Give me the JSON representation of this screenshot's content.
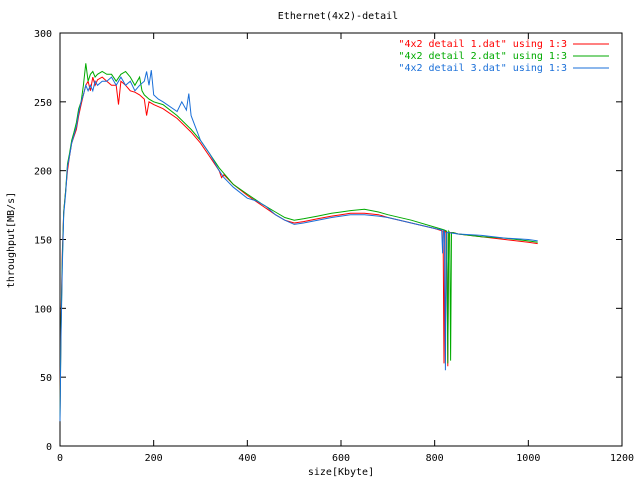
{
  "chart_data": {
    "type": "line",
    "title": "Ethernet(4x2)-detail",
    "xlabel": "size[Kbyte]",
    "ylabel": "throughput[MB/s]",
    "xlim": [
      0,
      1200
    ],
    "ylim": [
      0,
      300
    ],
    "xticks": [
      "0",
      "200",
      "400",
      "600",
      "800",
      "1000",
      "1200"
    ],
    "yticks": [
      "0",
      "50",
      "100",
      "150",
      "200",
      "250",
      "300"
    ],
    "grid": false,
    "legend_position": "top-right",
    "series": [
      {
        "name": "\"4x2 detail 1.dat\" using 1:3",
        "color": "#ff0000",
        "points": [
          [
            0,
            25
          ],
          [
            2,
            85
          ],
          [
            5,
            140
          ],
          [
            8,
            170
          ],
          [
            12,
            185
          ],
          [
            16,
            200
          ],
          [
            20,
            210
          ],
          [
            25,
            220
          ],
          [
            30,
            225
          ],
          [
            35,
            230
          ],
          [
            40,
            240
          ],
          [
            45,
            248
          ],
          [
            50,
            255
          ],
          [
            55,
            262
          ],
          [
            60,
            265
          ],
          [
            65,
            258
          ],
          [
            70,
            268
          ],
          [
            75,
            262
          ],
          [
            80,
            266
          ],
          [
            90,
            268
          ],
          [
            100,
            265
          ],
          [
            110,
            262
          ],
          [
            120,
            262
          ],
          [
            125,
            248
          ],
          [
            130,
            265
          ],
          [
            140,
            262
          ],
          [
            150,
            258
          ],
          [
            160,
            257
          ],
          [
            170,
            255
          ],
          [
            180,
            252
          ],
          [
            185,
            240
          ],
          [
            190,
            250
          ],
          [
            200,
            248
          ],
          [
            220,
            245
          ],
          [
            250,
            238
          ],
          [
            280,
            228
          ],
          [
            300,
            220
          ],
          [
            320,
            210
          ],
          [
            340,
            200
          ],
          [
            345,
            195
          ],
          [
            350,
            197
          ],
          [
            370,
            190
          ],
          [
            400,
            182
          ],
          [
            430,
            175
          ],
          [
            460,
            168
          ],
          [
            480,
            164
          ],
          [
            500,
            162
          ],
          [
            520,
            163
          ],
          [
            550,
            165
          ],
          [
            580,
            167
          ],
          [
            600,
            168
          ],
          [
            620,
            169
          ],
          [
            650,
            169
          ],
          [
            680,
            168
          ],
          [
            700,
            166
          ],
          [
            750,
            162
          ],
          [
            800,
            158
          ],
          [
            818,
            156
          ],
          [
            820,
            60
          ],
          [
            822,
            156
          ],
          [
            826,
            155
          ],
          [
            828,
            58
          ],
          [
            830,
            155
          ],
          [
            840,
            155
          ],
          [
            850,
            154
          ],
          [
            900,
            152
          ],
          [
            950,
            150
          ],
          [
            1000,
            148
          ],
          [
            1020,
            147
          ]
        ]
      },
      {
        "name": "\"4x2 detail 2.dat\" using 1:3",
        "color": "#00aa00",
        "points": [
          [
            0,
            20
          ],
          [
            2,
            80
          ],
          [
            5,
            135
          ],
          [
            8,
            170
          ],
          [
            12,
            185
          ],
          [
            16,
            205
          ],
          [
            20,
            212
          ],
          [
            25,
            222
          ],
          [
            30,
            228
          ],
          [
            35,
            235
          ],
          [
            40,
            245
          ],
          [
            45,
            250
          ],
          [
            50,
            262
          ],
          [
            55,
            278
          ],
          [
            60,
            265
          ],
          [
            65,
            270
          ],
          [
            70,
            272
          ],
          [
            75,
            268
          ],
          [
            80,
            270
          ],
          [
            90,
            272
          ],
          [
            100,
            270
          ],
          [
            110,
            270
          ],
          [
            120,
            265
          ],
          [
            130,
            270
          ],
          [
            140,
            272
          ],
          [
            150,
            268
          ],
          [
            160,
            262
          ],
          [
            170,
            268
          ],
          [
            175,
            258
          ],
          [
            180,
            255
          ],
          [
            190,
            252
          ],
          [
            200,
            250
          ],
          [
            220,
            248
          ],
          [
            250,
            240
          ],
          [
            280,
            230
          ],
          [
            300,
            222
          ],
          [
            320,
            212
          ],
          [
            340,
            202
          ],
          [
            350,
            198
          ],
          [
            370,
            190
          ],
          [
            400,
            183
          ],
          [
            430,
            176
          ],
          [
            460,
            170
          ],
          [
            480,
            166
          ],
          [
            500,
            164
          ],
          [
            520,
            165
          ],
          [
            550,
            167
          ],
          [
            580,
            169
          ],
          [
            600,
            170
          ],
          [
            620,
            171
          ],
          [
            650,
            172
          ],
          [
            680,
            170
          ],
          [
            700,
            168
          ],
          [
            750,
            164
          ],
          [
            800,
            159
          ],
          [
            820,
            157
          ],
          [
            826,
            156
          ],
          [
            828,
            60
          ],
          [
            830,
            156
          ],
          [
            832,
            155
          ],
          [
            834,
            62
          ],
          [
            836,
            155
          ],
          [
            840,
            155
          ],
          [
            850,
            154
          ],
          [
            900,
            152
          ],
          [
            950,
            151
          ],
          [
            1000,
            149
          ],
          [
            1020,
            148
          ]
        ]
      },
      {
        "name": "\"4x2 detail 3.dat\" using 1:3",
        "color": "#1a6fd8",
        "points": [
          [
            0,
            18
          ],
          [
            2,
            75
          ],
          [
            5,
            130
          ],
          [
            8,
            168
          ],
          [
            12,
            183
          ],
          [
            16,
            203
          ],
          [
            20,
            210
          ],
          [
            25,
            220
          ],
          [
            30,
            226
          ],
          [
            35,
            232
          ],
          [
            40,
            242
          ],
          [
            45,
            250
          ],
          [
            50,
            255
          ],
          [
            55,
            262
          ],
          [
            60,
            258
          ],
          [
            65,
            262
          ],
          [
            70,
            258
          ],
          [
            75,
            265
          ],
          [
            80,
            262
          ],
          [
            90,
            265
          ],
          [
            100,
            265
          ],
          [
            110,
            268
          ],
          [
            120,
            262
          ],
          [
            130,
            268
          ],
          [
            140,
            262
          ],
          [
            150,
            265
          ],
          [
            160,
            258
          ],
          [
            170,
            262
          ],
          [
            180,
            265
          ],
          [
            185,
            272
          ],
          [
            190,
            262
          ],
          [
            195,
            273
          ],
          [
            200,
            255
          ],
          [
            210,
            252
          ],
          [
            220,
            250
          ],
          [
            250,
            243
          ],
          [
            260,
            250
          ],
          [
            270,
            244
          ],
          [
            275,
            256
          ],
          [
            280,
            240
          ],
          [
            300,
            222
          ],
          [
            320,
            212
          ],
          [
            340,
            200
          ],
          [
            350,
            195
          ],
          [
            370,
            188
          ],
          [
            400,
            180
          ],
          [
            420,
            178
          ],
          [
            440,
            174
          ],
          [
            460,
            168
          ],
          [
            480,
            164
          ],
          [
            500,
            161
          ],
          [
            520,
            162
          ],
          [
            550,
            164
          ],
          [
            580,
            166
          ],
          [
            600,
            167
          ],
          [
            620,
            168
          ],
          [
            650,
            168
          ],
          [
            680,
            167
          ],
          [
            700,
            166
          ],
          [
            750,
            162
          ],
          [
            800,
            158
          ],
          [
            815,
            157
          ],
          [
            817,
            140
          ],
          [
            819,
            157
          ],
          [
            821,
            155
          ],
          [
            823,
            55
          ],
          [
            825,
            155
          ],
          [
            830,
            155
          ],
          [
            850,
            154
          ],
          [
            900,
            153
          ],
          [
            950,
            151
          ],
          [
            1000,
            150
          ],
          [
            1020,
            149
          ]
        ]
      }
    ]
  }
}
